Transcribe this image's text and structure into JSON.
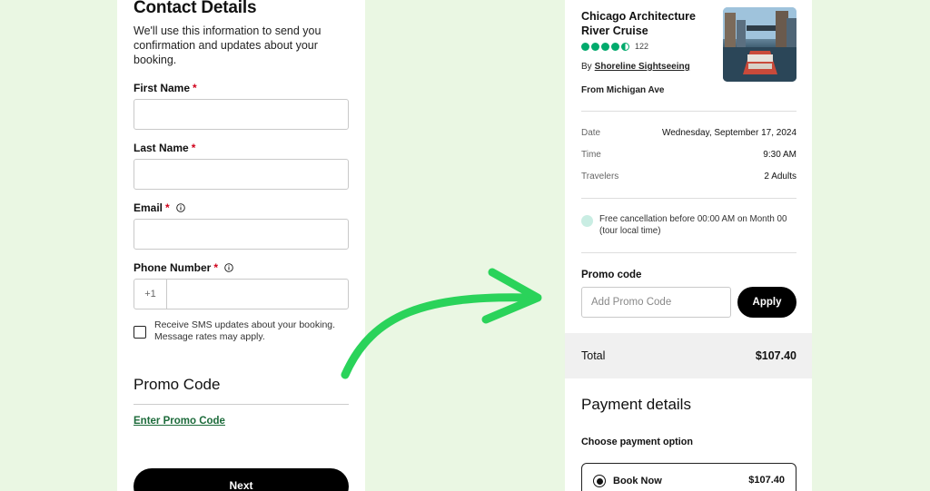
{
  "contact": {
    "title": "Contact Details",
    "subtitle": "We'll use this information to send you confirmation and updates about your booking.",
    "first_name_label": "First Name",
    "last_name_label": "Last Name",
    "email_label": "Email",
    "phone_label": "Phone Number",
    "required_mark": "*",
    "country_code": "+1",
    "sms_text": "Receive SMS updates about your booking. Message rates may apply.",
    "promo_title": "Promo Code",
    "promo_link": "Enter Promo Code",
    "next_label": "Next"
  },
  "summary": {
    "tour_title": "Chicago Architecture River Cruise",
    "rating": 4.5,
    "review_count": "122",
    "by_prefix": "By",
    "operator": "Shoreline Sightseeing",
    "from": "From Michigan Ave",
    "details": [
      {
        "key": "Date",
        "value": "Wednesday, September 17, 2024"
      },
      {
        "key": "Time",
        "value": "9:30 AM"
      },
      {
        "key": "Travelers",
        "value": "2 Adults"
      }
    ],
    "cancellation": "Free cancellation before 00:00 AM on Month 00 (tour local time)",
    "promo_label": "Promo code",
    "promo_placeholder": "Add Promo Code",
    "apply_label": "Apply",
    "total_label": "Total",
    "total_value": "$107.40",
    "payment_title": "Payment details",
    "choose_label": "Choose payment option",
    "option_label": "Book Now",
    "option_value": "$107.40"
  },
  "colors": {
    "background": "#eaf7e3",
    "rating_green": "#00aa6c",
    "arrow_green": "#2ad35a",
    "required_red": "#d0021b",
    "link_green": "#1d6b3b"
  }
}
